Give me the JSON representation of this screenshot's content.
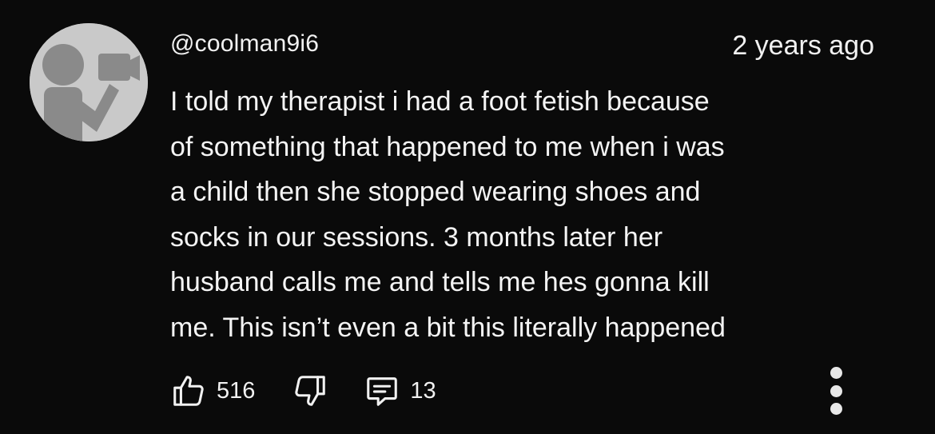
{
  "comment": {
    "username": "@coolman9i6",
    "timestamp": "2 years ago",
    "body_lines": [
      "I told my therapist i had a foot fetish because",
      "of something that happened to me when i was",
      "a child then she stopped wearing shoes and",
      "socks in our sessions. 3 months later her",
      "husband calls me and tells me hes gonna kill",
      "me. This isn’t even a bit this literally happened"
    ],
    "like_count": "516",
    "reply_count": "13"
  },
  "icons": {
    "avatar": "default-avatar-icon",
    "like": "thumbs-up-icon",
    "dislike": "thumbs-down-icon",
    "reply": "comment-reply-icon",
    "more": "more-vertical-icon"
  },
  "colors": {
    "background": "#0a0a0a",
    "text": "#f1f1f1",
    "avatar_bg": "#c9c9c9",
    "avatar_fg": "#8a8a8a"
  }
}
